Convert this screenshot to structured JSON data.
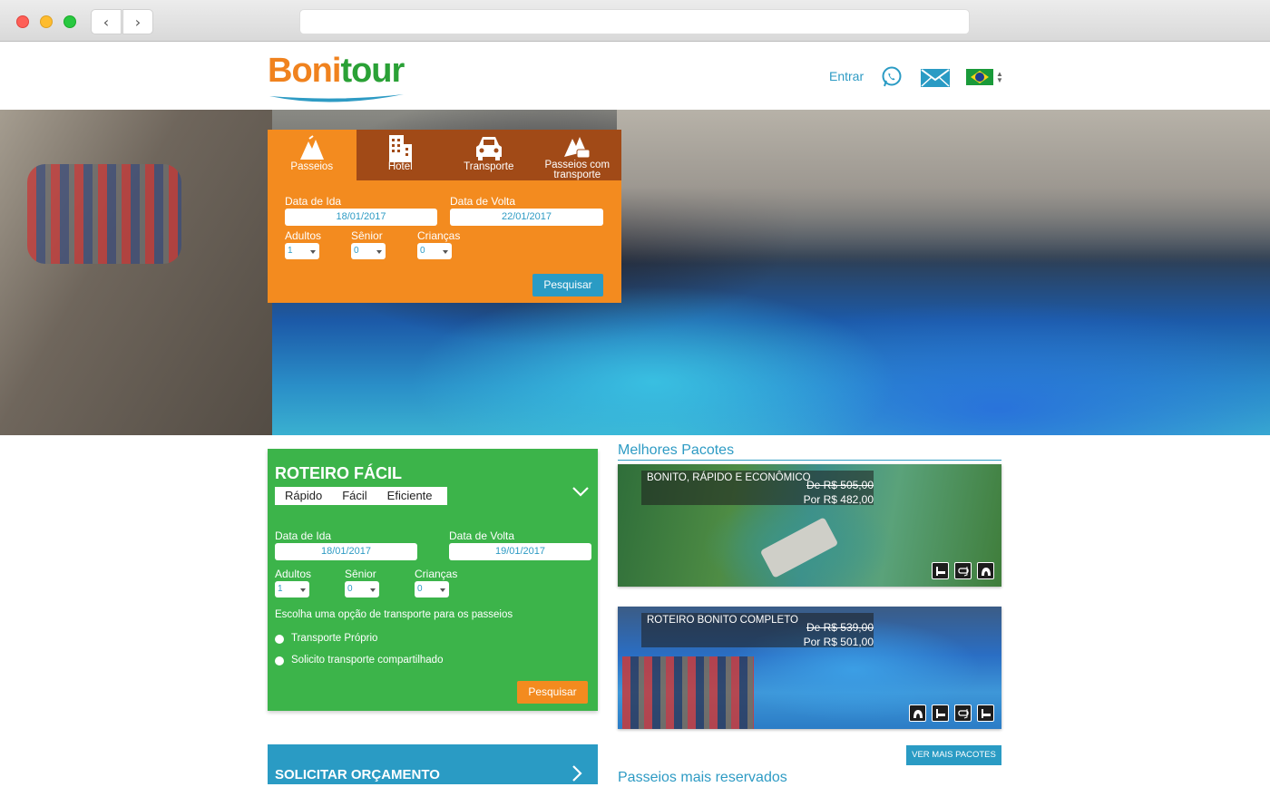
{
  "header": {
    "logo_boni": "Boni",
    "logo_tour": "tour",
    "login_label": "Entrar"
  },
  "search": {
    "tabs": [
      {
        "label": "Passeios"
      },
      {
        "label": "Hotel"
      },
      {
        "label": "Transporte"
      },
      {
        "label": "Passeios com transporte"
      }
    ],
    "date_in_label": "Data de Ida",
    "date_in_value": "18/01/2017",
    "date_out_label": "Data de Volta",
    "date_out_value": "22/01/2017",
    "adults_label": "Adultos",
    "adults_value": "1",
    "senior_label": "Sênior",
    "senior_value": "0",
    "children_label": "Crianças",
    "children_value": "0",
    "submit_label": "Pesquisar"
  },
  "roteiro": {
    "title": "ROTEIRO FÁCIL",
    "tags": [
      "Rápido",
      "Fácil",
      "Eficiente"
    ],
    "date_in_label": "Data de Ida",
    "date_in_value": "18/01/2017",
    "date_out_label": "Data de Volta",
    "date_out_value": "19/01/2017",
    "adults_label": "Adultos",
    "adults_value": "1",
    "senior_label": "Sênior",
    "senior_value": "0",
    "children_label": "Crianças",
    "children_value": "0",
    "transport_prompt": "Escolha uma opção de transporte para os passeios",
    "option_own": "Transporte Próprio",
    "option_shared": "Solicito transporte compartilhado",
    "submit_label": "Pesquisar"
  },
  "quote": {
    "label": "SOLICITAR ORÇAMENTO"
  },
  "packages": {
    "title": "Melhores Pacotes",
    "items": [
      {
        "name": "BONITO, RÁPIDO E ECONÔMICO",
        "old_price": "De R$ 505,00",
        "new_price": "Por R$ 482,00"
      },
      {
        "name": "ROTEIRO BONITO COMPLETO",
        "old_price": "De R$ 539,00",
        "new_price": "Por R$ 501,00"
      }
    ],
    "more_label": "VER MAIS PACOTES"
  },
  "popular": {
    "title": "Passeios mais reservados"
  },
  "colors": {
    "orange": "#f38b1f",
    "green": "#3cb44a",
    "blue": "#2a9bc4",
    "brown_tabs": "#a14a17"
  }
}
